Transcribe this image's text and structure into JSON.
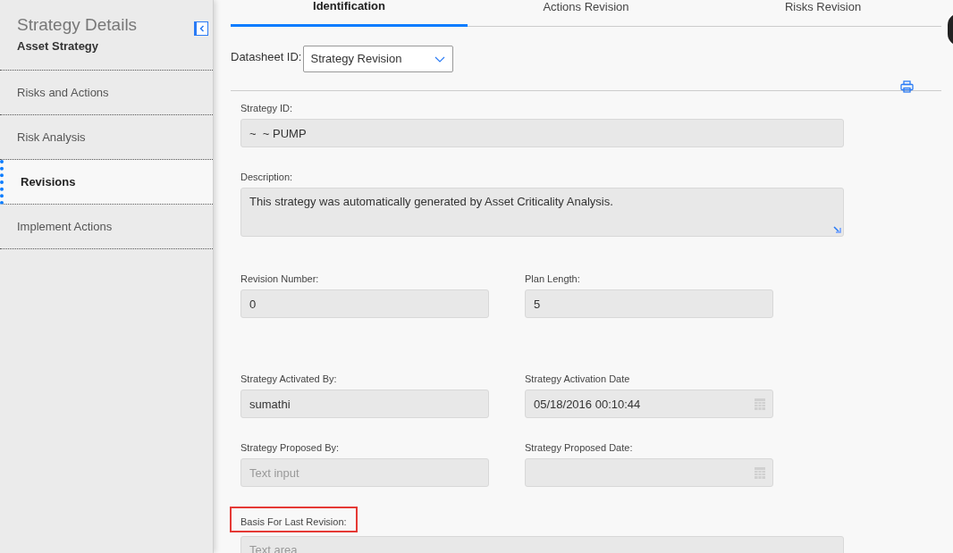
{
  "sidebar": {
    "title": "Strategy Details",
    "subtitle": "Asset Strategy",
    "items": [
      {
        "label": "Risks and Actions",
        "selected": false
      },
      {
        "label": "Risk Analysis",
        "selected": false
      },
      {
        "label": "Revisions",
        "selected": true
      },
      {
        "label": "Implement Actions",
        "selected": false
      }
    ]
  },
  "tabs": [
    {
      "label": "Identification",
      "selected": true
    },
    {
      "label": "Actions Revision",
      "selected": false
    },
    {
      "label": "Risks Revision",
      "selected": false
    }
  ],
  "datasheet": {
    "label": "Datasheet ID:",
    "value": "Strategy Revision"
  },
  "form_rows": [
    {
      "fields": [
        {
          "kind": "text",
          "wide": true,
          "label": "Strategy ID:",
          "value": "~  ~ PUMP",
          "highlighted": false
        }
      ]
    },
    {
      "fields": [
        {
          "kind": "textarea",
          "wide": true,
          "label": "Description:",
          "value": "This strategy was automatically generated by Asset Criticality Analysis.",
          "highlighted": false
        }
      ]
    },
    {
      "fields": [
        {
          "kind": "text",
          "wide": false,
          "label": "Revision Number:",
          "value": "0",
          "highlighted": false
        },
        {
          "kind": "text",
          "wide": false,
          "label": "Plan Length:",
          "value": "5",
          "highlighted": false
        }
      ]
    },
    {
      "fields": [
        {
          "kind": "text",
          "wide": false,
          "label": "Strategy Activated By:",
          "value": "sumathi",
          "highlighted": false
        },
        {
          "kind": "date",
          "wide": false,
          "label": "Strategy Activation Date",
          "value": "05/18/2016 00:10:44",
          "highlighted": false
        }
      ]
    },
    {
      "fields": [
        {
          "kind": "text",
          "wide": false,
          "label": "Strategy Proposed By:",
          "placeholder": "Text input",
          "highlighted": false
        },
        {
          "kind": "date",
          "wide": false,
          "label": "Strategy Proposed Date:",
          "highlighted": false
        }
      ]
    },
    {
      "fields": [
        {
          "kind": "textarea",
          "wide": true,
          "label": "Basis For Last Revision:",
          "placeholder": "Text area",
          "highlighted": true
        }
      ]
    }
  ]
}
